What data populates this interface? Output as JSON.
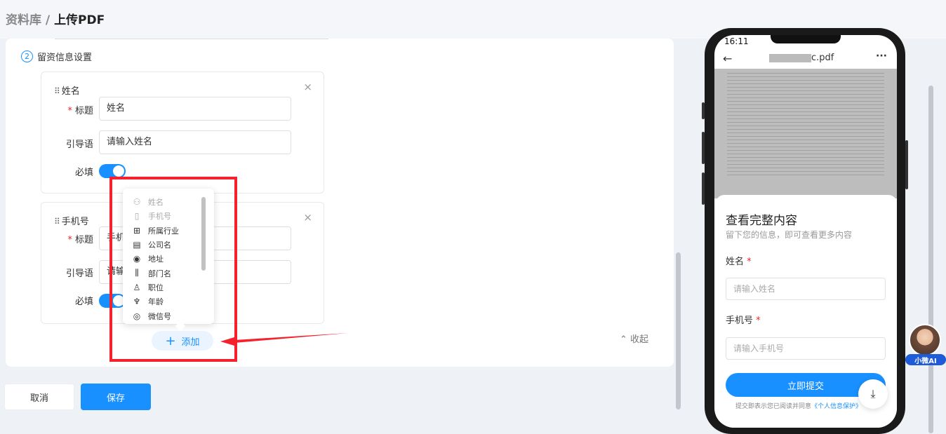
{
  "breadcrumb": {
    "root": "资料库 /",
    "current": "上传PDF"
  },
  "section": {
    "step": "2",
    "title": "留资信息设置"
  },
  "fields": [
    {
      "title": "姓名",
      "label_title": "标题",
      "title_value": "姓名",
      "label_guide": "引导语",
      "guide_value": "请输入姓名",
      "label_required": "必填",
      "close": "×"
    },
    {
      "title": "手机号",
      "label_title": "标题",
      "title_value": "手机号",
      "label_guide": "引导语",
      "guide_value": "请输入手机号",
      "label_required": "必填",
      "close": "×"
    }
  ],
  "dropdown": {
    "items": [
      {
        "label": "姓名",
        "icon": "user-icon",
        "disabled": true
      },
      {
        "label": "手机号",
        "icon": "phone-icon",
        "disabled": true
      },
      {
        "label": "所属行业",
        "icon": "grid-icon",
        "disabled": false
      },
      {
        "label": "公司名",
        "icon": "building-icon",
        "disabled": false
      },
      {
        "label": "地址",
        "icon": "location-icon",
        "disabled": false
      },
      {
        "label": "部门名",
        "icon": "department-icon",
        "disabled": false
      },
      {
        "label": "职位",
        "icon": "badge-icon",
        "disabled": false
      },
      {
        "label": "年龄",
        "icon": "sprout-icon",
        "disabled": false
      },
      {
        "label": "微信号",
        "icon": "wechat-icon",
        "disabled": false
      }
    ]
  },
  "add_button": "添加",
  "collapse": "收起",
  "actions": {
    "cancel": "取消",
    "save": "保存"
  },
  "phone": {
    "time": "16:11",
    "file_suffix": ".pdf",
    "sheet": {
      "title": "查看完整内容",
      "subtitle": "留下您的信息，即可查看更多内容",
      "name_label": "姓名",
      "name_placeholder": "请输入姓名",
      "phone_label": "手机号",
      "phone_placeholder": "请输入手机号",
      "submit": "立即提交",
      "note_prefix": "提交即表示您已阅读并同意",
      "note_link": "《个人信息保护》"
    }
  },
  "assistant": {
    "tag": "小微AI"
  },
  "colors": {
    "accent": "#1890ff",
    "highlight": "#f5222d"
  }
}
